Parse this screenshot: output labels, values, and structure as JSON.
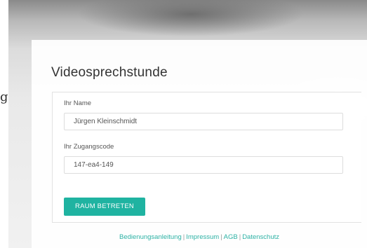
{
  "page": {
    "title": "Videosprechstunde",
    "edge_glyph": "g"
  },
  "form": {
    "name_label": "Ihr Name",
    "name_value": "Jürgen Kleinschmidt",
    "code_label": "Ihr Zugangscode",
    "code_value": "147-ea4-149",
    "submit_label": "RAUM BETRETEN"
  },
  "footer": {
    "links": [
      "Bedienungsanleitung",
      "Impressum",
      "AGB",
      "Datenschutz"
    ],
    "separator": "|"
  },
  "colors": {
    "accent": "#1fb3a1",
    "link": "#2db2a5"
  }
}
